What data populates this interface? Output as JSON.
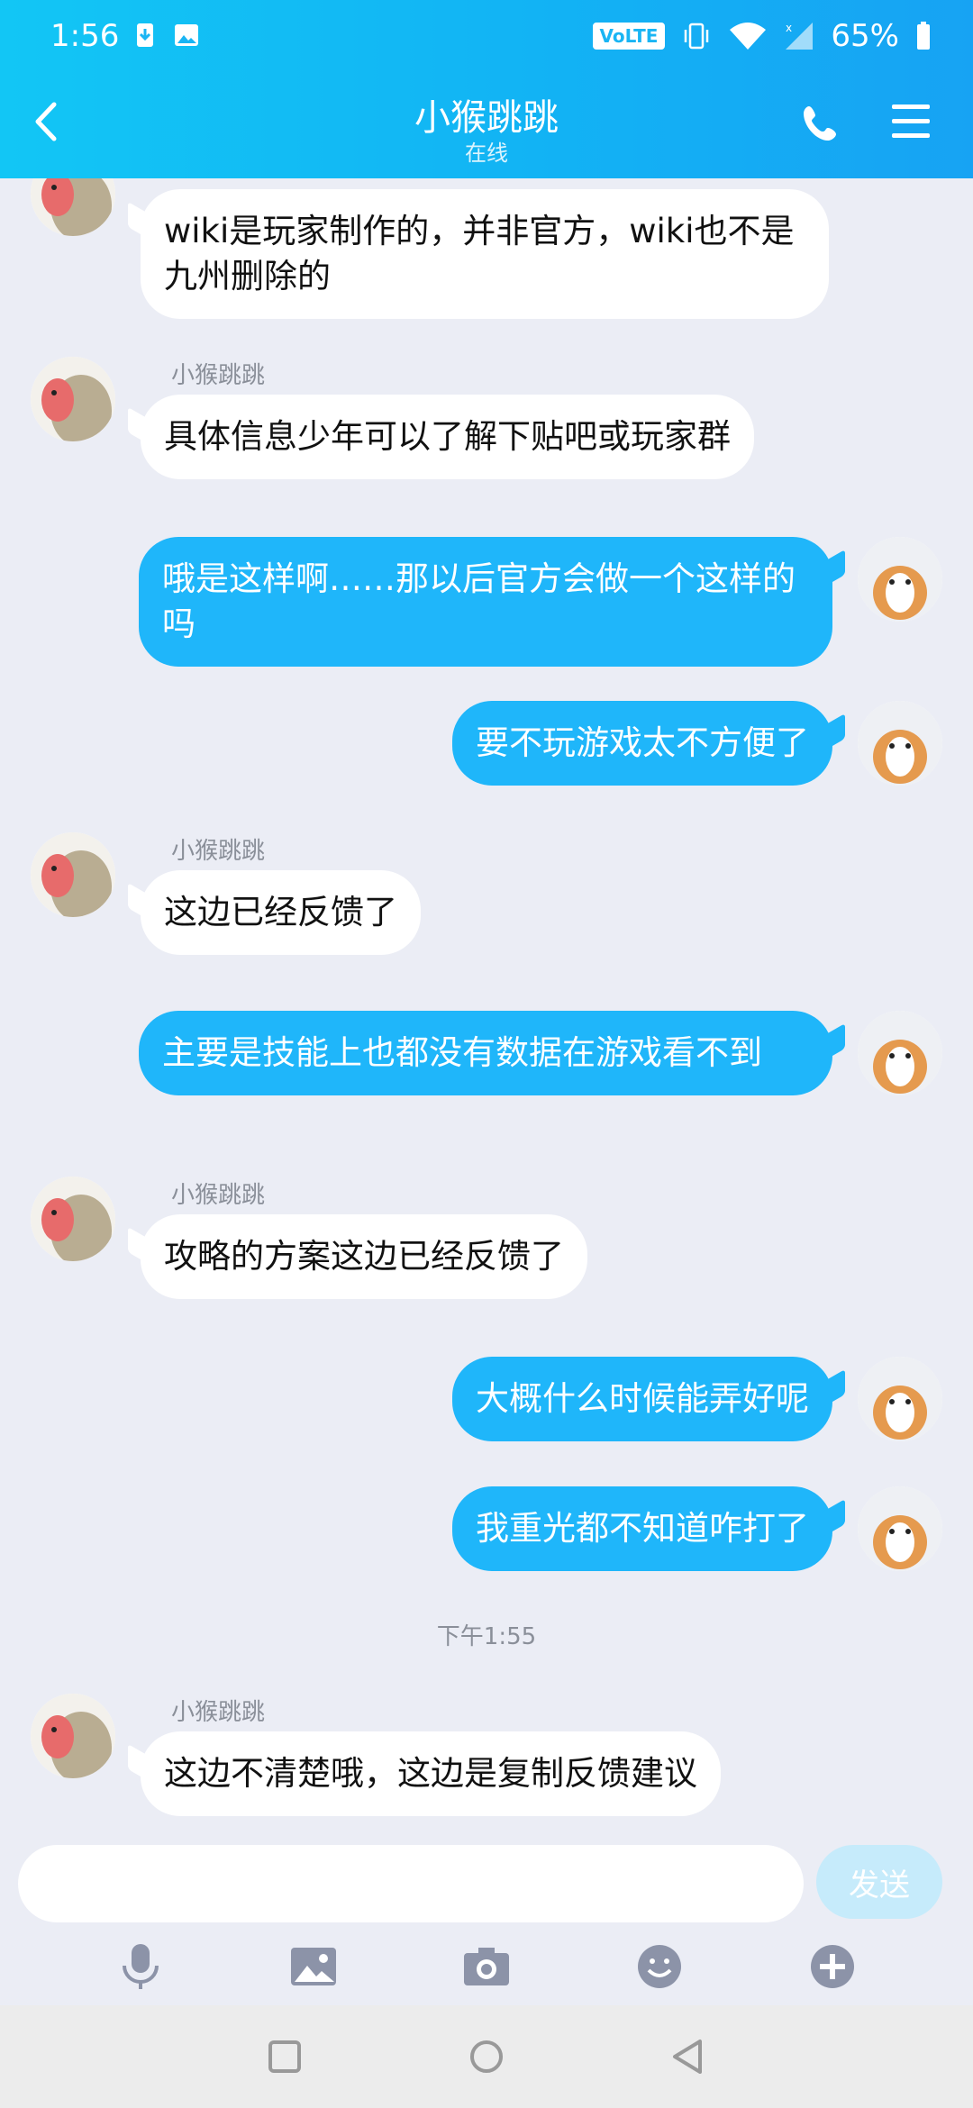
{
  "status_bar": {
    "time": "1:56",
    "volte": "VoLTE",
    "battery": "65%"
  },
  "header": {
    "title": "小猴跳跳",
    "subtitle": "在线"
  },
  "messages": [
    {
      "side": "in",
      "sender": "",
      "text": "wiki是玩家制作的，并非官方，wiki也不是九州删除的"
    },
    {
      "side": "in",
      "sender": "小猴跳跳",
      "text": "具体信息少年可以了解下贴吧或玩家群"
    },
    {
      "side": "out",
      "text": "哦是这样啊……那以后官方会做一个这样的吗"
    },
    {
      "side": "out",
      "text": "要不玩游戏太不方便了"
    },
    {
      "side": "in",
      "sender": "小猴跳跳",
      "text": "这边已经反馈了"
    },
    {
      "side": "out",
      "text": "主要是技能上也都没有数据在游戏看不到"
    },
    {
      "side": "in",
      "sender": "小猴跳跳",
      "text": "攻略的方案这边已经反馈了"
    },
    {
      "side": "out",
      "text": "大概什么时候能弄好呢"
    },
    {
      "side": "out",
      "text": "我重光都不知道咋打了"
    },
    {
      "side": "in",
      "sender": "小猴跳跳",
      "text": "这边不清楚哦，这边是复制反馈建议"
    }
  ],
  "time_separator": "下午1:55",
  "input": {
    "placeholder": "",
    "send_label": "发送"
  },
  "toolbar": {
    "icons": [
      "microphone-icon",
      "image-icon",
      "camera-icon",
      "emoji-icon",
      "plus-icon"
    ]
  },
  "colors": {
    "header": "#12b3f4",
    "out_bubble": "#1fb6fa",
    "background": "#ebedf5"
  }
}
